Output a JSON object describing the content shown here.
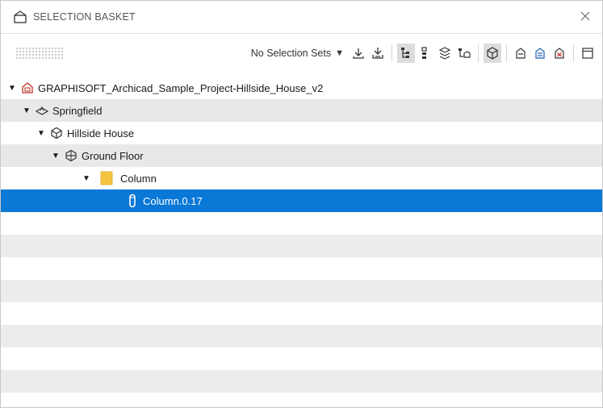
{
  "panel": {
    "title": "SELECTION BASKET"
  },
  "toolbar": {
    "selection_sets_label": "No Selection Sets",
    "dropdown_arrow": "▼",
    "buttons": [
      {
        "icon": "download-icon"
      },
      {
        "icon": "download-all-icon"
      },
      {
        "icon": "tree-view-icon",
        "active": true
      },
      {
        "icon": "list-view-icon"
      },
      {
        "icon": "layers-view-icon"
      },
      {
        "icon": "floor-view-icon"
      },
      {
        "icon": "isolate-3d-icon"
      },
      {
        "icon": "remove-item-icon"
      },
      {
        "icon": "remove-type-icon"
      },
      {
        "icon": "clear-basket-icon"
      },
      {
        "icon": "window-icon"
      }
    ]
  },
  "tree": {
    "rows": [
      {
        "label": "GRAPHISOFT_Archicad_Sample_Project-Hillside_House_v2",
        "icon": "project-icon",
        "expanded": true
      },
      {
        "label": "Springfield",
        "icon": "site-icon",
        "expanded": true
      },
      {
        "label": "Hillside House",
        "icon": "building-icon",
        "expanded": true
      },
      {
        "label": "Ground Floor",
        "icon": "storey-icon",
        "expanded": true
      },
      {
        "label": "Column",
        "icon": "folder-icon",
        "expanded": true
      },
      {
        "label": "Column.0.17",
        "icon": "column-icon",
        "selected": true
      }
    ],
    "caret_glyph": "▼"
  },
  "colors": {
    "selection": "#0a78d7",
    "alt_row": "#e8e8e8",
    "folder": "#f5c542",
    "project_icon": "#c0392b"
  }
}
